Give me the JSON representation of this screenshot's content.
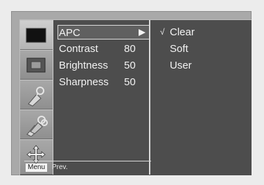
{
  "menu": {
    "items": [
      {
        "label": "APC",
        "value": "",
        "selected": true
      },
      {
        "label": "Contrast",
        "value": "80"
      },
      {
        "label": "Brightness",
        "value": "50"
      },
      {
        "label": "Sharpness",
        "value": "50"
      }
    ]
  },
  "options": [
    {
      "label": "Clear",
      "checked": true,
      "mark": "√"
    },
    {
      "label": "Soft",
      "checked": false,
      "mark": ""
    },
    {
      "label": "User",
      "checked": false,
      "mark": ""
    }
  ],
  "footer": {
    "menu_key": "Menu",
    "prev_label": "Prev."
  },
  "icons": [
    "picture-icon",
    "screen-icon",
    "sound-tag-icon",
    "special-tags-icon",
    "move-arrows-icon"
  ],
  "colors": {
    "panel": "#4d4d4d",
    "icon_column": "#9a9a9a",
    "text": "#f2f2f2"
  }
}
